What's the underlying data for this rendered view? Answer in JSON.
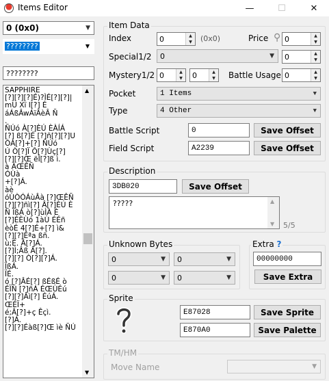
{
  "window": {
    "title": "Items Editor",
    "minimize": "—",
    "maximize": "☐",
    "close": "✕"
  },
  "left": {
    "item_select": "0   (0x0)",
    "name_combo": "????????",
    "name_field": "????????",
    "list_lines": [
      "SAPPHIRE",
      "[?][?][?]É)?ÌÉ[?][?]|",
      "mU  Xï  I[?]  É",
      "áÁßÂwÁïÂèÂ  Ñ",
      ".",
      "ÑÚó À[?]ÈÚ ÈÀÍÁ",
      "[?] ß[?]É [?]ñ[?][?]U",
      " ÓÁ[?]+[?] ÑÚó",
      "Ú Ò[?]Ï Ô[?]Ùç[?]",
      "[?][?]Œ ëÎ[?]ß ì.",
      "à ÀŒÊÑ",
      "ÓÙà",
      "+[?]Á.",
      "àè",
      "óÙÒÓÁùÂà [?]ŒÊÑ",
      "[?][?]ñì[?] Â[?]ÈÚ È",
      "Ñ ÏßÁ ò[?]ùÌÀ È",
      "[?]ÉÈÙó 1àÙ ÉÉñ",
      "èòÉ 4[?]É+[?] ì&",
      "[?][?]Éªa ßñ.",
      "ù;É. Â[?]Á.",
      " [?]Ì;Âß Â[?].",
      "[?][?] Ò[?][?]Á.",
      "ÏßÁ.",
      "ÏÉ.",
      "ó [?]ÂÉ[?] ßÉßÉ ò",
      "ÉÏÑ [?]ñÁ ÉŒÙÉú",
      "[?][?]Âì[?] ÉúÁ.",
      "ŒÉÏ+",
      "é;Â[?]+ç Êçì.",
      "[?]Á.",
      "[?][?]Éàß[?]Œ ìè ÑÚ"
    ]
  },
  "item_data": {
    "title": "Item Data",
    "index_label": "Index",
    "index_value": "0",
    "index_hex": "(0x0)",
    "price_label": "Price",
    "price_value": "0",
    "special_label": "Special1/2",
    "special_combo": "0",
    "special_value": "0",
    "mystery_label": "Mystery1/2",
    "mystery1": "0",
    "mystery2": "0",
    "battle_usage_label": "Battle Usage",
    "battle_usage_value": "0",
    "pocket_label": "Pocket",
    "pocket_value": "1 Items",
    "type_label": "Type",
    "type_value": "4 Other",
    "battle_script_label": "Battle Script",
    "battle_script_value": "0",
    "field_script_label": "Field Script",
    "field_script_value": "A2239",
    "save_offset_label": "Save Offset"
  },
  "description": {
    "title": "Description",
    "offset": "3DB020",
    "save_label": "Save Offset",
    "text": "?????",
    "counter": "5/5"
  },
  "unknown_bytes": {
    "title": "Unknown Bytes",
    "values": [
      "0",
      "0",
      "0",
      "0"
    ]
  },
  "extra": {
    "title": "Extra",
    "help": "?",
    "value": "00000000",
    "save_label": "Save Extra"
  },
  "sprite": {
    "title": "Sprite",
    "sprite_offset": "E87028",
    "palette_offset": "E870A0",
    "save_sprite_label": "Save Sprite",
    "save_palette_label": "Save Palette"
  },
  "tmhm": {
    "title": "TM/HM",
    "move_name_label": "Move Name",
    "move_name_value": ""
  },
  "colors": {
    "help_blue": "#1a6fd1",
    "window_bg": "#f0f0f0"
  }
}
